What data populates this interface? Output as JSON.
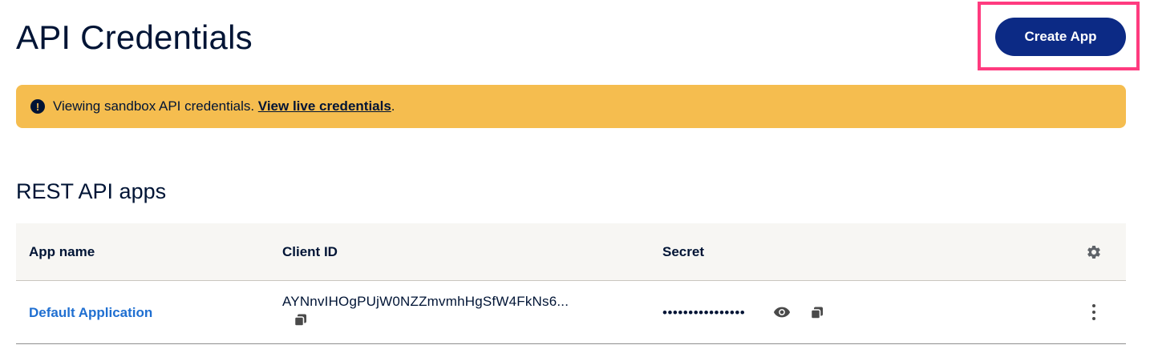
{
  "header": {
    "title": "API Credentials",
    "create_app_label": "Create App"
  },
  "banner": {
    "icon": "exclamation-circle-icon",
    "icon_glyph": "!",
    "text": "Viewing sandbox API credentials. ",
    "link_text": "View live credentials",
    "suffix": ".",
    "color": "#f5bd4f"
  },
  "rest_apps": {
    "section_title": "REST API apps",
    "columns": {
      "app_name": "App name",
      "client_id": "Client ID",
      "secret": "Secret",
      "settings_icon": "gear-icon"
    },
    "rows": [
      {
        "app_name": "Default Application",
        "client_id": "AYNnvIHOgPUjW0NZZmvmhHgSfW4FkNs6...",
        "secret_masked": "••••••••••••••••"
      }
    ]
  },
  "colors": {
    "primary_button": "#0c2a85",
    "link": "#1f6fd1",
    "highlight": "#ff3b7f",
    "text": "#001435"
  }
}
